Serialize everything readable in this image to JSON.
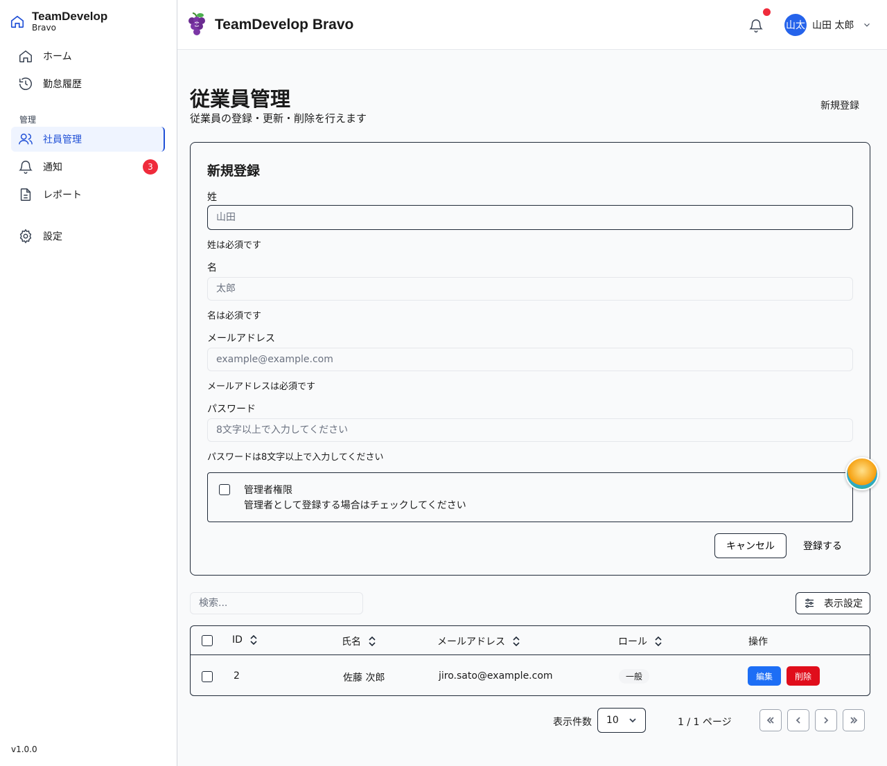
{
  "brand": {
    "title": "TeamDevelop",
    "subtitle": "Bravo"
  },
  "sidebar": {
    "items": [
      {
        "label": "ホーム",
        "icon": "home-icon"
      },
      {
        "label": "勤怠履歴",
        "icon": "history-icon"
      }
    ],
    "section_label": "管理",
    "admin_items": [
      {
        "label": "社員管理",
        "icon": "users-icon",
        "active": true
      },
      {
        "label": "通知",
        "icon": "bell-icon",
        "badge": "3"
      },
      {
        "label": "レポート",
        "icon": "document-icon"
      }
    ],
    "settings": {
      "label": "設定",
      "icon": "gear-icon"
    },
    "version": "v1.0.0"
  },
  "header": {
    "title": "TeamDevelop Bravo",
    "user": {
      "avatar_text": "山太",
      "name": "山田 太郎"
    }
  },
  "page": {
    "title": "従業員管理",
    "subtitle": "従業員の登録・更新・削除を行えます",
    "new_button": "新規登録"
  },
  "form": {
    "title": "新規登録",
    "last_name": {
      "label": "姓",
      "placeholder": "山田",
      "error": "姓は必須です"
    },
    "first_name": {
      "label": "名",
      "placeholder": "太郎",
      "error": "名は必須です"
    },
    "email": {
      "label": "メールアドレス",
      "placeholder": "example@example.com",
      "error": "メールアドレスは必須です"
    },
    "password": {
      "label": "パスワード",
      "placeholder": "8文字以上で入力してください",
      "error": "パスワードは8文字以上で入力してください"
    },
    "admin": {
      "title": "管理者権限",
      "description": "管理者として登録する場合はチェックしてください"
    },
    "cancel": "キャンセル",
    "submit": "登録する"
  },
  "table_tools": {
    "search_placeholder": "検索...",
    "view_settings": "表示設定"
  },
  "table": {
    "columns": [
      "ID",
      "氏名",
      "メールアドレス",
      "ロール",
      "操作"
    ],
    "rows": [
      {
        "id": "2",
        "name": "佐藤 次郎",
        "email": "jiro.sato@example.com",
        "role": "一般",
        "edit": "編集",
        "delete": "削除"
      }
    ]
  },
  "pagination": {
    "per_page_label": "表示件数",
    "per_page": "10",
    "page_info": "1 / 1 ページ"
  },
  "colors": {
    "accent": "#1d6ef5",
    "danger": "#e00d1b",
    "badge": "#ef2b3b",
    "active_nav": "#1f4fd6"
  }
}
